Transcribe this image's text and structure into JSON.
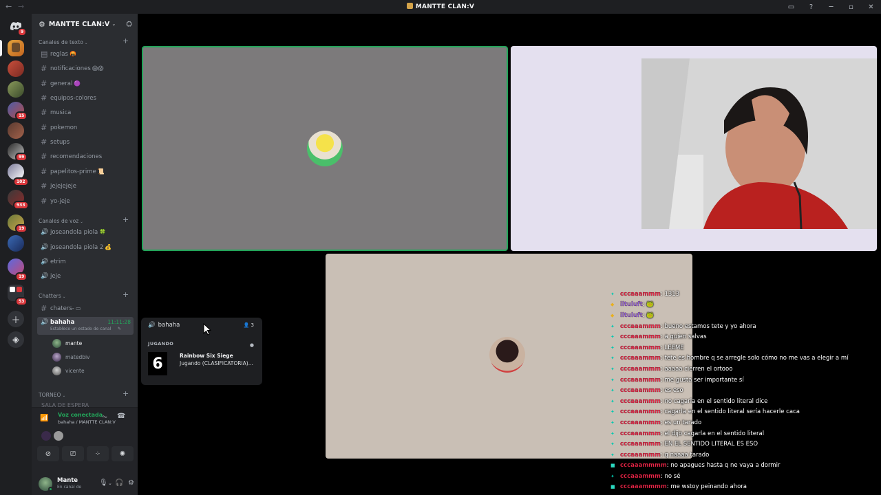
{
  "titlebar": {
    "title": "MANTTE CLAN:V",
    "back_icon": "←",
    "inbox_icon": "▭",
    "help_icon": "?",
    "min": "─",
    "max": "▫",
    "close": "✕"
  },
  "rail": {
    "home_badge": "9",
    "badges": [
      "15",
      "99",
      "102",
      "933",
      "19",
      "6",
      "19",
      "53"
    ]
  },
  "server": {
    "name": "MANTTE CLAN:V"
  },
  "categories": {
    "text": "Canales de texto",
    "voice": "Canales de voz",
    "chatters": "Chatters",
    "torneo": "TORNEO",
    "partial": "SALA DE ESPERA"
  },
  "text_channels": [
    {
      "name": "reglas",
      "emoji": "🤬",
      "icon": "rules"
    },
    {
      "name": "notificaciones",
      "emoji": "😱😱"
    },
    {
      "name": "general",
      "emoji": "🟣"
    },
    {
      "name": "equipos-colores",
      "emoji": ""
    },
    {
      "name": "musica",
      "emoji": ""
    },
    {
      "name": "pokemon",
      "emoji": ""
    },
    {
      "name": "setups",
      "emoji": ""
    },
    {
      "name": "recomendaciones",
      "emoji": ""
    },
    {
      "name": "papelitos-prime",
      "emoji": "📜"
    },
    {
      "name": "jejejejeje",
      "emoji": ""
    },
    {
      "name": "yo-jeje",
      "emoji": ""
    }
  ],
  "voice_channels": [
    {
      "name": "joseandola piola",
      "emoji": "🍀"
    },
    {
      "name": "joseandola piola 2",
      "emoji": "💰"
    },
    {
      "name": "etrim",
      "emoji": ""
    },
    {
      "name": "jeje",
      "emoji": ""
    }
  ],
  "chatters_channel": {
    "name": "chaters-",
    "emoji": "▭"
  },
  "active_voice": {
    "name": "bahaha",
    "time": "11:11:28",
    "status": "Establece un estado de canal"
  },
  "voice_users": [
    "mante",
    "matedbiv",
    "vicente"
  ],
  "voice_panel": {
    "connected": "Voz conectada",
    "server": "bahaha / MANTTE CLAN:V"
  },
  "user_panel": {
    "name": "Mante",
    "status": "En canal de"
  },
  "hover_card": {
    "channel": "bahaha",
    "count": "3",
    "playing_label": "JUGANDO",
    "game_icon": "6",
    "game": "Rainbow Six Siege",
    "detail": "Jugando (CLASIFICATORIA)..."
  },
  "chat": [
    {
      "user": "cccaaammm",
      "text": "1313",
      "icon": "✦",
      "alt": false
    },
    {
      "user": "iltuluft",
      "text": "🐸",
      "icon": "◆",
      "alt": true
    },
    {
      "user": "iltuluft",
      "text": "🐸",
      "icon": "◆",
      "alt": true
    },
    {
      "user": "cccaaammm",
      "text": "bueno estamos tete y yo ahora",
      "icon": "✦",
      "alt": false
    },
    {
      "user": "cccaaammm",
      "text": "a quien salvas",
      "icon": "✦",
      "alt": false
    },
    {
      "user": "cccaaammm",
      "text": "LEEME",
      "icon": "✦",
      "alt": false
    },
    {
      "user": "cccaaammm",
      "text": "tete es hombre q se arregle solo cómo no me vas a elegir a mí",
      "icon": "✦",
      "alt": false
    },
    {
      "user": "cccaaammm",
      "text": "aaaaa cierren el ortooo",
      "icon": "✦",
      "alt": false
    },
    {
      "user": "cccaaammm",
      "text": "me gusta ser importante sí",
      "icon": "✦",
      "alt": false
    },
    {
      "user": "cccaaammm",
      "text": "es eso",
      "icon": "✦",
      "alt": false
    },
    {
      "user": "cccaaammm",
      "text": "no cagarla en el sentido literal dice",
      "icon": "✦",
      "alt": false
    },
    {
      "user": "cccaaammm",
      "text": "cagarla en el sentido literal sería hacerle caca",
      "icon": "✦",
      "alt": false
    },
    {
      "user": "cccaaammm",
      "text": "es un tarado",
      "icon": "✦",
      "alt": false
    },
    {
      "user": "cccaaammm",
      "text": "el dijo cagarla en el sentido literal",
      "icon": "✦",
      "alt": false
    },
    {
      "user": "cccaaammm",
      "text": "EN EL SENTIDO LITERAL ES ESO",
      "icon": "✦",
      "alt": false
    },
    {
      "user": "cccaaammm",
      "text": "q naaaa tarado",
      "icon": "✦",
      "alt": false
    },
    {
      "user": "cccaaammmm",
      "text": "no apagues hasta q ne vaya a dormir",
      "icon": "■",
      "alt": false
    },
    {
      "user": "cccaaammm",
      "text": "no sé",
      "icon": "✦",
      "alt": false
    },
    {
      "user": "cccaaammmm",
      "text": "me wstoy peinando ahora",
      "icon": "■",
      "alt": false
    }
  ]
}
